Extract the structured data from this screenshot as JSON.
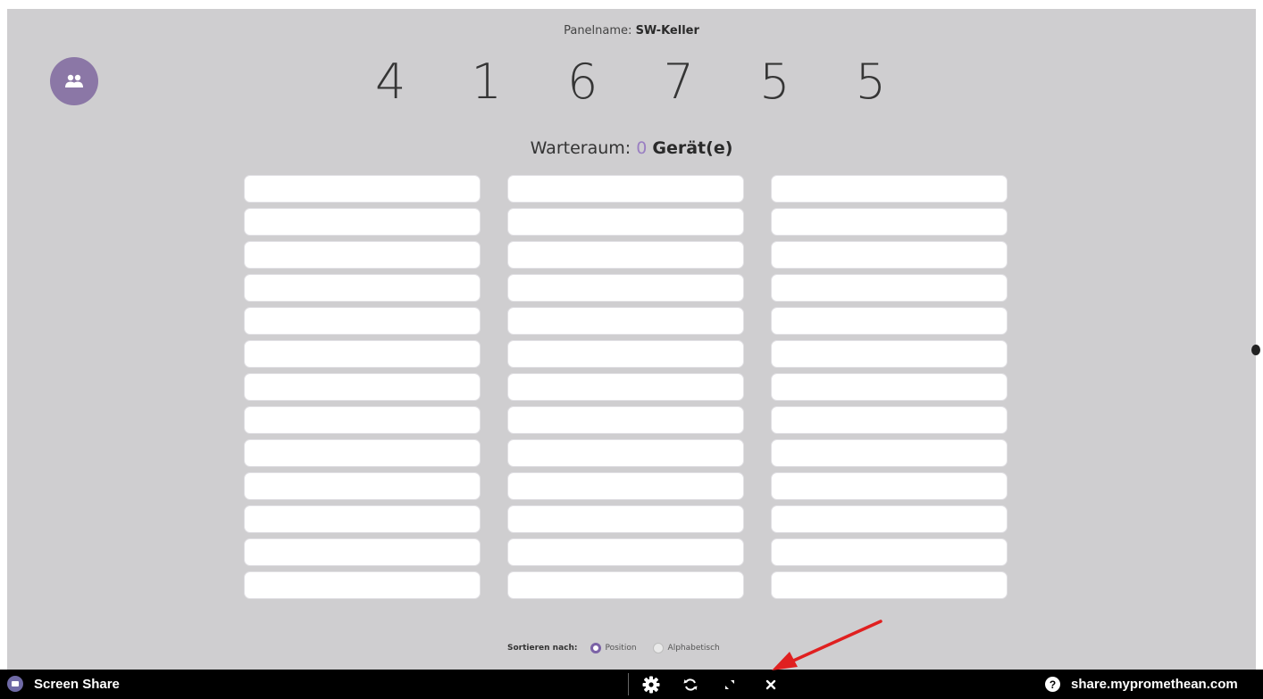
{
  "panel": {
    "label": "Panelname:",
    "name": "SW-Keller"
  },
  "code": "4 1 6 7 5 5",
  "waiting_room": {
    "label": "Warteraum:",
    "count": "0",
    "unit": "Gerät(e)"
  },
  "device_slots": {
    "columns": 3,
    "rows": 13
  },
  "sort": {
    "label": "Sortieren nach:",
    "options": [
      {
        "label": "Position",
        "selected": true
      },
      {
        "label": "Alphabetisch",
        "selected": false
      }
    ]
  },
  "taskbar": {
    "app_name": "Screen Share",
    "controls": [
      "gear-icon",
      "refresh-icon",
      "minimize-icon",
      "close-icon"
    ],
    "help_url": "share.mypromethean.com"
  },
  "colors": {
    "accent": "#8b77a6",
    "background": "#cfced0",
    "taskbar": "#000000",
    "annotation_arrow": "#e02020"
  }
}
